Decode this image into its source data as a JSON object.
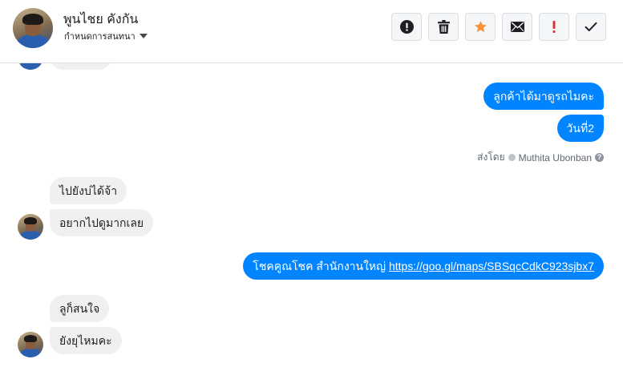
{
  "header": {
    "contact_name": "พูนไชย คังกัน",
    "assign_label": "กำหนดการสนทนา",
    "actions": [
      {
        "name": "spam-button",
        "icon": "exclamation-circle-icon"
      },
      {
        "name": "delete-button",
        "icon": "trash-icon"
      },
      {
        "name": "star-button",
        "icon": "star-icon",
        "color": "#f7923b"
      },
      {
        "name": "mark-unread-button",
        "icon": "envelope-icon"
      },
      {
        "name": "follow-up-button",
        "icon": "exclamation-icon",
        "color": "#e0332f"
      },
      {
        "name": "mark-done-button",
        "icon": "checkmark-icon"
      }
    ]
  },
  "thread": {
    "outgoing_1": "ลูกค้าได้มาดูรถไมคะ",
    "outgoing_2": "วันที่2",
    "sent_by_prefix": "ส่งโดย",
    "sent_by_name": "Muthita Ubonban",
    "incoming_1": "ไปยังบ่ได้จ้า",
    "incoming_2": "อยากไปดูมากเลย",
    "outgoing_3_text": "โชคคูณโชค สำนักงานใหญ่ ",
    "outgoing_3_link": "https://goo.gl/maps/SBSqcCdkC923sjbx7",
    "incoming_3": "ลูก็สนใจ",
    "incoming_4": "ยังยุไหมคะ"
  },
  "colors": {
    "outgoing_bubble": "#0084ff",
    "incoming_bubble": "#f1f0f0"
  }
}
